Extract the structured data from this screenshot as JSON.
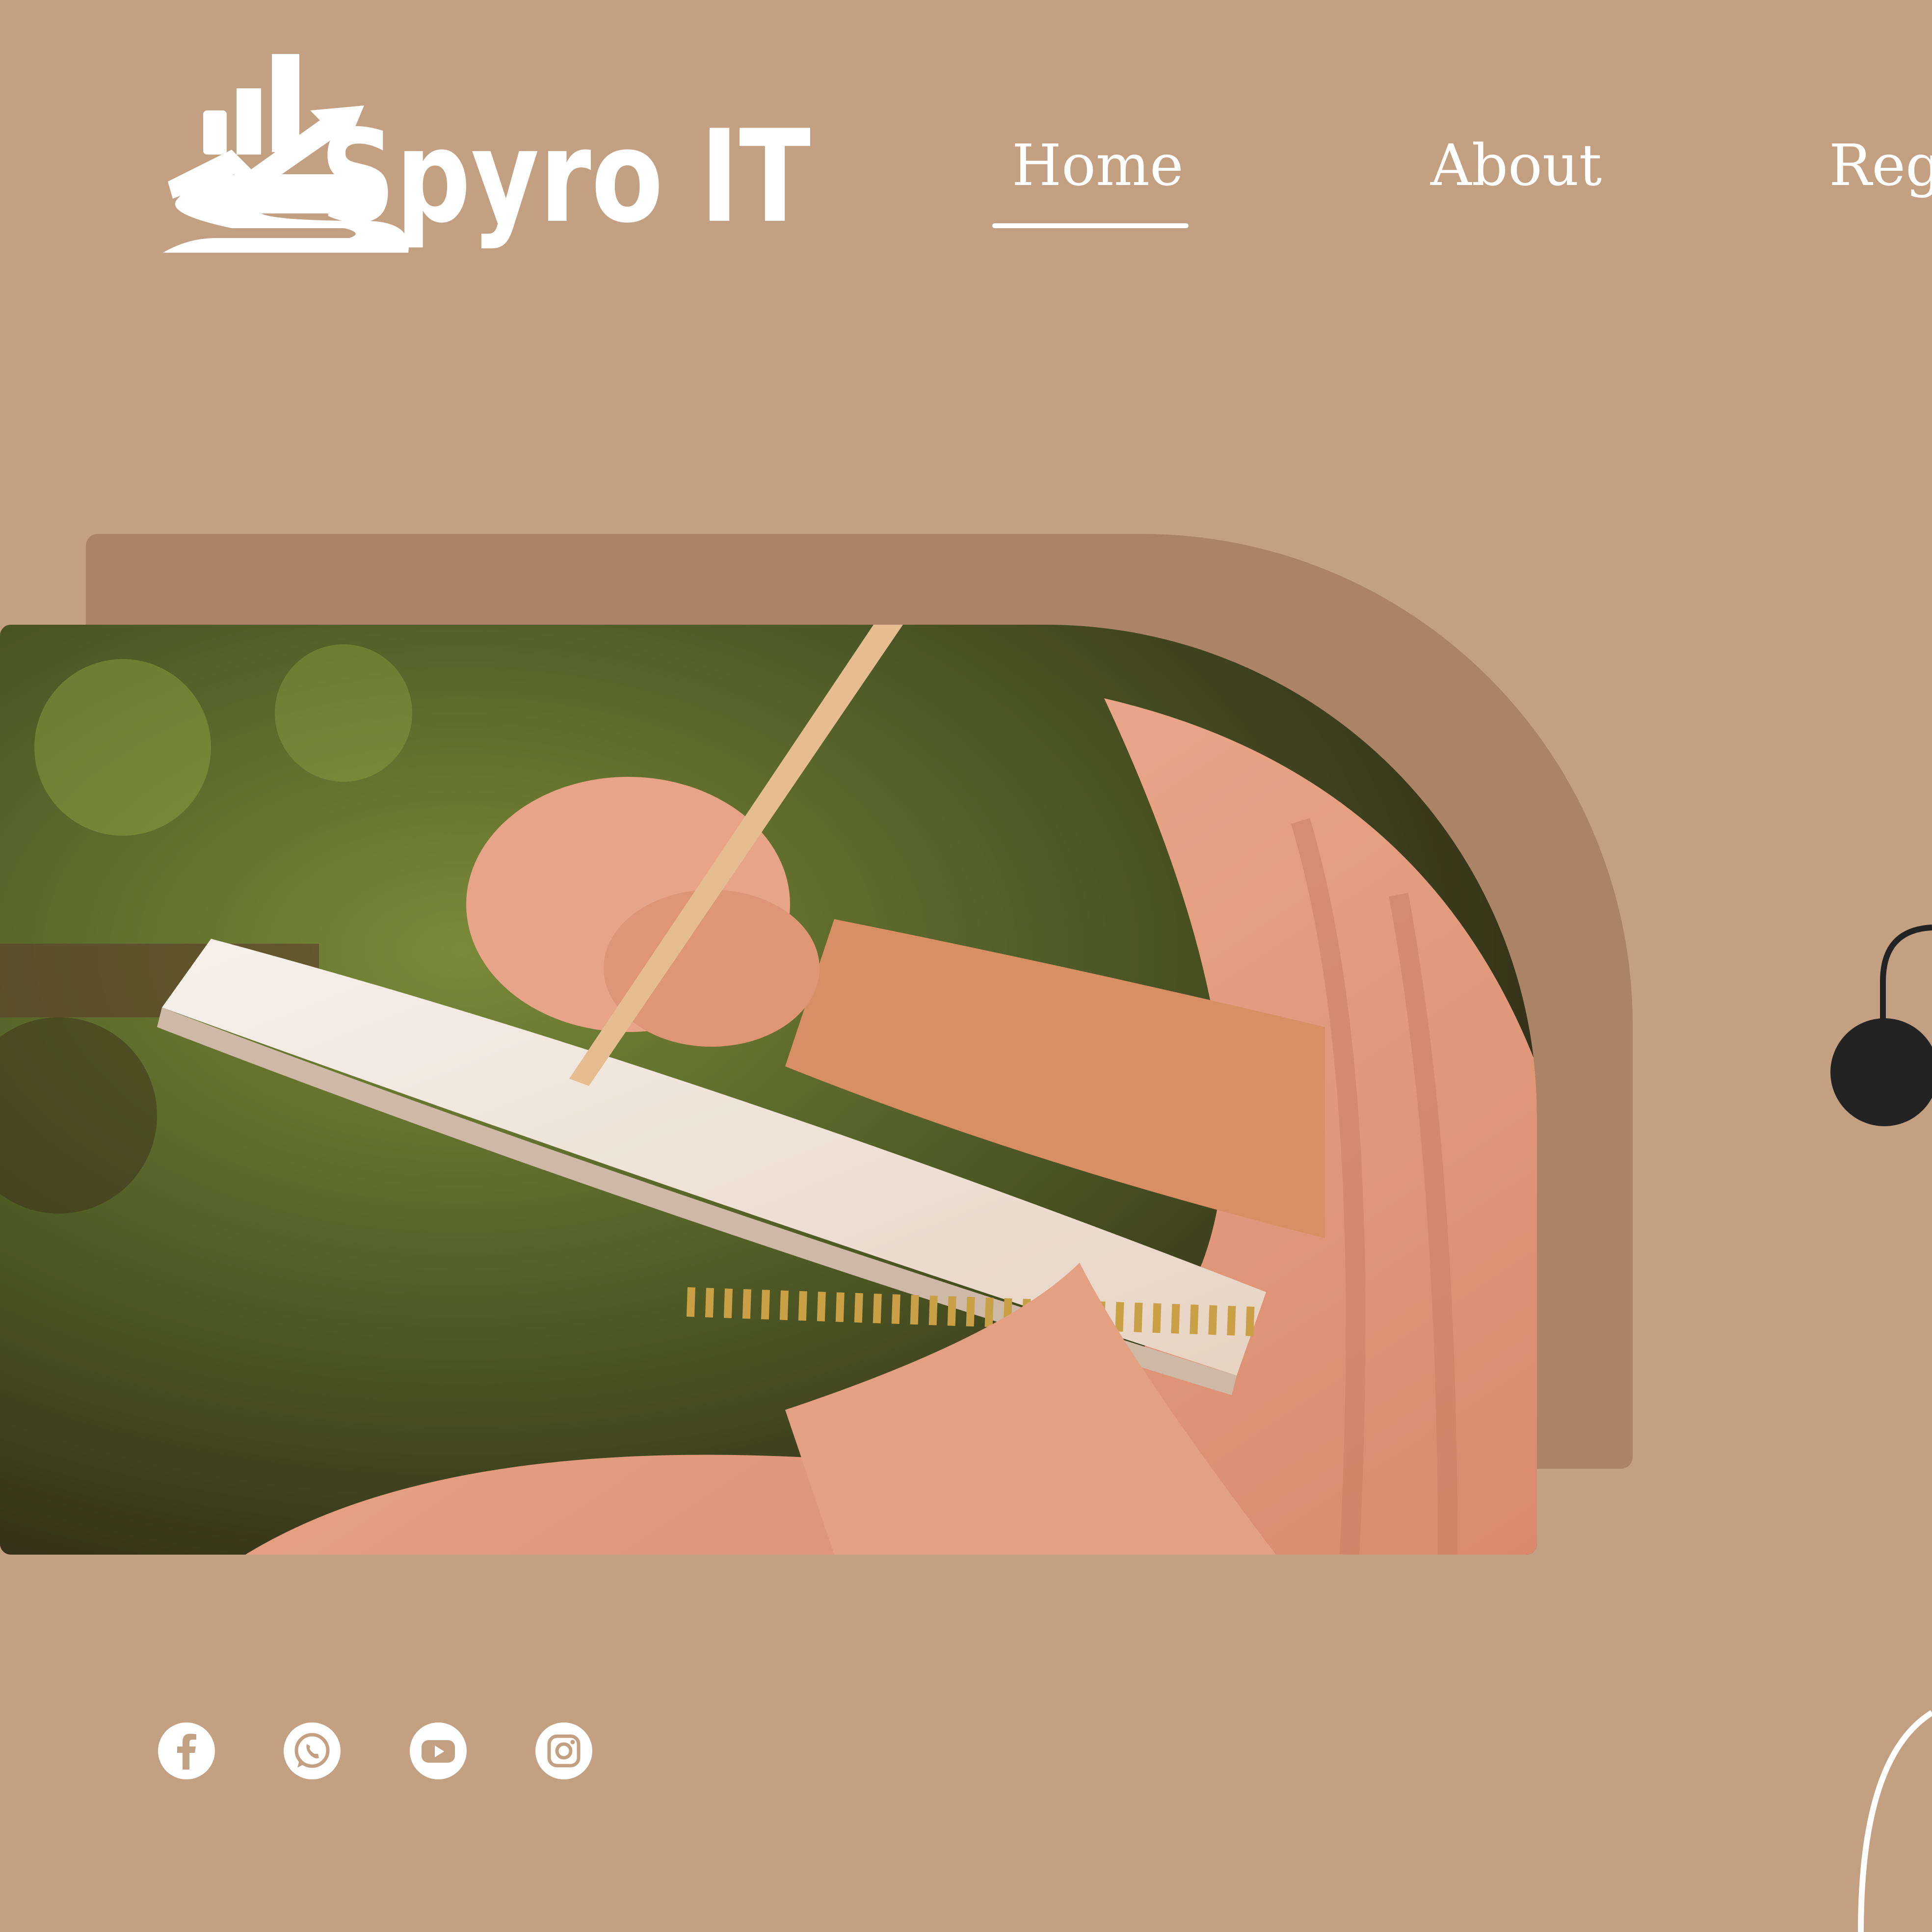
{
  "brand": {
    "name": "Spyro IT",
    "logo_icon": "rising-bar-chart-arrow-icon"
  },
  "nav": {
    "items": [
      {
        "label": "Home",
        "active": true
      },
      {
        "label": "About",
        "active": false
      },
      {
        "label": "Regi",
        "active": false
      }
    ]
  },
  "hero": {
    "image_icon": "photo-hand-writing-in-notebook"
  },
  "social": [
    {
      "name": "facebook",
      "icon": "facebook-icon"
    },
    {
      "name": "whatsapp",
      "icon": "whatsapp-icon"
    },
    {
      "name": "youtube",
      "icon": "youtube-icon"
    },
    {
      "name": "instagram",
      "icon": "instagram-icon"
    }
  ],
  "colors": {
    "background": "#c4a083",
    "arch": "#ab8467",
    "text": "#ffffff",
    "dark_accent": "#232323"
  }
}
